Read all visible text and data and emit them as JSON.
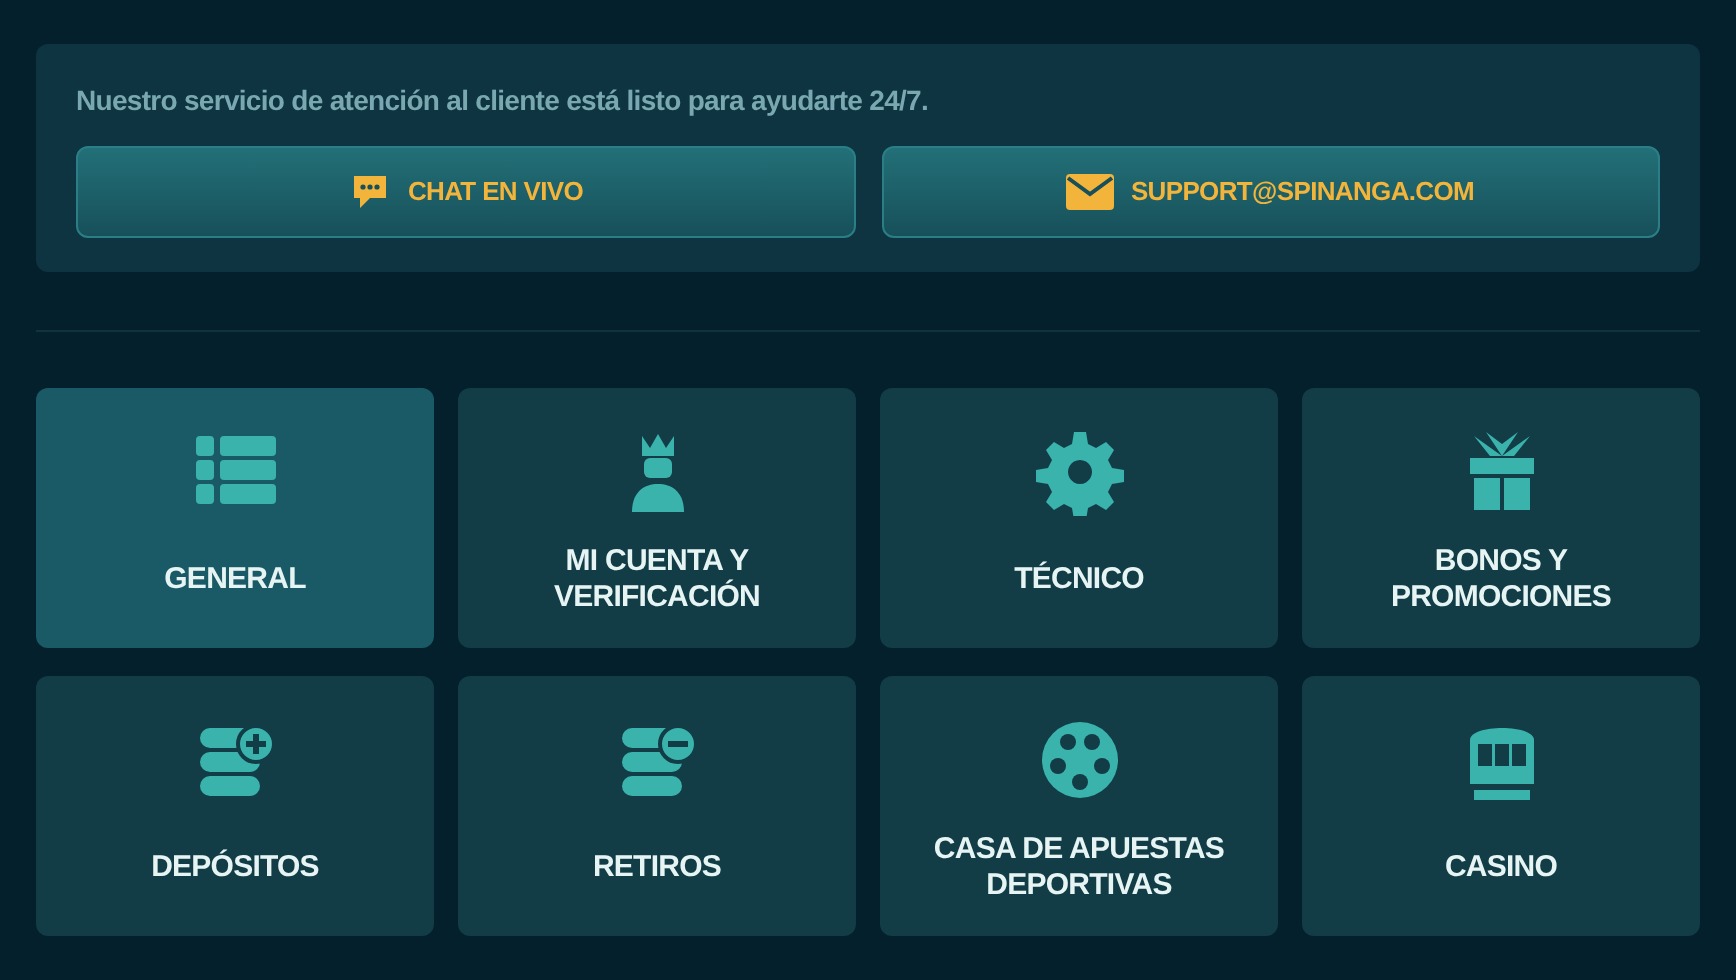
{
  "support": {
    "message": "Nuestro servicio de atención al cliente está listo para ayudarte 24/7.",
    "buttons": [
      {
        "kind": "chat",
        "label": "CHAT EN VIVO"
      },
      {
        "kind": "email",
        "label": "SUPPORT@SPINANGA.COM"
      }
    ]
  },
  "categories": [
    {
      "kind": "list",
      "label": "GENERAL",
      "selected": true
    },
    {
      "kind": "account",
      "label": "MI CUENTA Y VERIFICACIÓN",
      "selected": false
    },
    {
      "kind": "gear",
      "label": "TÉCNICO",
      "selected": false
    },
    {
      "kind": "gift",
      "label": "BONOS Y PROMOCIONES",
      "selected": false
    },
    {
      "kind": "deposit",
      "label": "DEPÓSITOS",
      "selected": false
    },
    {
      "kind": "withdraw",
      "label": "RETIROS",
      "selected": false
    },
    {
      "kind": "ball",
      "label": "CASA DE APUESTAS DEPORTIVAS",
      "selected": false
    },
    {
      "kind": "slot",
      "label": "CASINO",
      "selected": false
    }
  ]
}
